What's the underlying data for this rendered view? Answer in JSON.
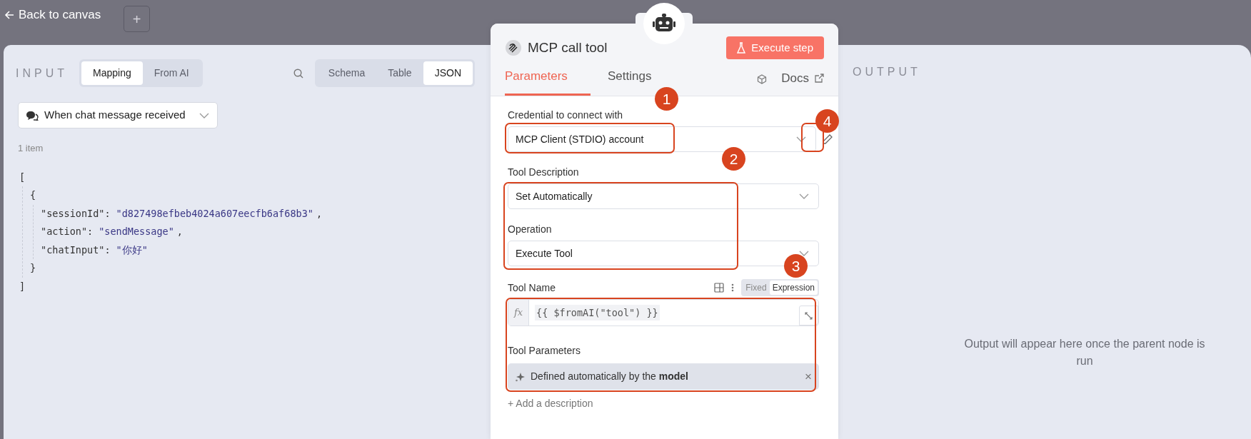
{
  "header": {
    "back_label": "Back to canvas",
    "add_label": "+"
  },
  "input_panel": {
    "title": "INPUT",
    "mode_tabs": [
      {
        "label": "Mapping",
        "selected": true
      },
      {
        "label": "From AI",
        "selected": false
      }
    ],
    "view_tabs": [
      {
        "label": "Schema",
        "selected": false
      },
      {
        "label": "Table",
        "selected": false
      },
      {
        "label": "JSON",
        "selected": true
      }
    ],
    "source": "When chat message received",
    "item_count": "1 item",
    "json_view": {
      "open": "[",
      "close": "]",
      "items": [
        {
          "open": "{",
          "close": "}",
          "fields": [
            {
              "key": "\"sessionId\":",
              "value": "\"d827498efbeb4024a607eecfb6af68b3\"",
              "comma": ","
            },
            {
              "key": "\"action\":",
              "value": "\"sendMessage\"",
              "comma": ","
            },
            {
              "key": "\"chatInput\":",
              "value": "\"你好\""
            }
          ]
        }
      ]
    }
  },
  "node": {
    "title": "MCP call tool",
    "execute_label": "Execute step",
    "tabs": [
      {
        "label": "Parameters",
        "selected": true
      },
      {
        "label": "Settings",
        "selected": false
      }
    ],
    "docs_label": "Docs",
    "fields": [
      {
        "kind": "select",
        "label": "Credential to connect with",
        "value": "MCP Client (STDIO) account",
        "has_edit": true
      },
      {
        "kind": "select",
        "label": "Tool Description",
        "value": "Set Automatically"
      },
      {
        "kind": "select",
        "label": "Operation",
        "value": "Execute Tool"
      },
      {
        "kind": "expression",
        "label": "Tool Name",
        "prefix": "fx",
        "value": "{{ $fromAI(\"tool\") }}",
        "modes": [
          {
            "label": "Fixed",
            "selected": false
          },
          {
            "label": "Expression",
            "selected": true
          }
        ]
      },
      {
        "kind": "auto",
        "label": "Tool Parameters",
        "value": "Defined automatically by the **model**",
        "clear": "×"
      }
    ],
    "add_link": "+ Add a description"
  },
  "output_panel": {
    "title": "OUTPUT",
    "message": "Output will appear here once the parent node is run"
  },
  "annotations": [
    {
      "number": "1"
    },
    {
      "number": "2"
    },
    {
      "number": "3"
    },
    {
      "number": "4"
    }
  ]
}
